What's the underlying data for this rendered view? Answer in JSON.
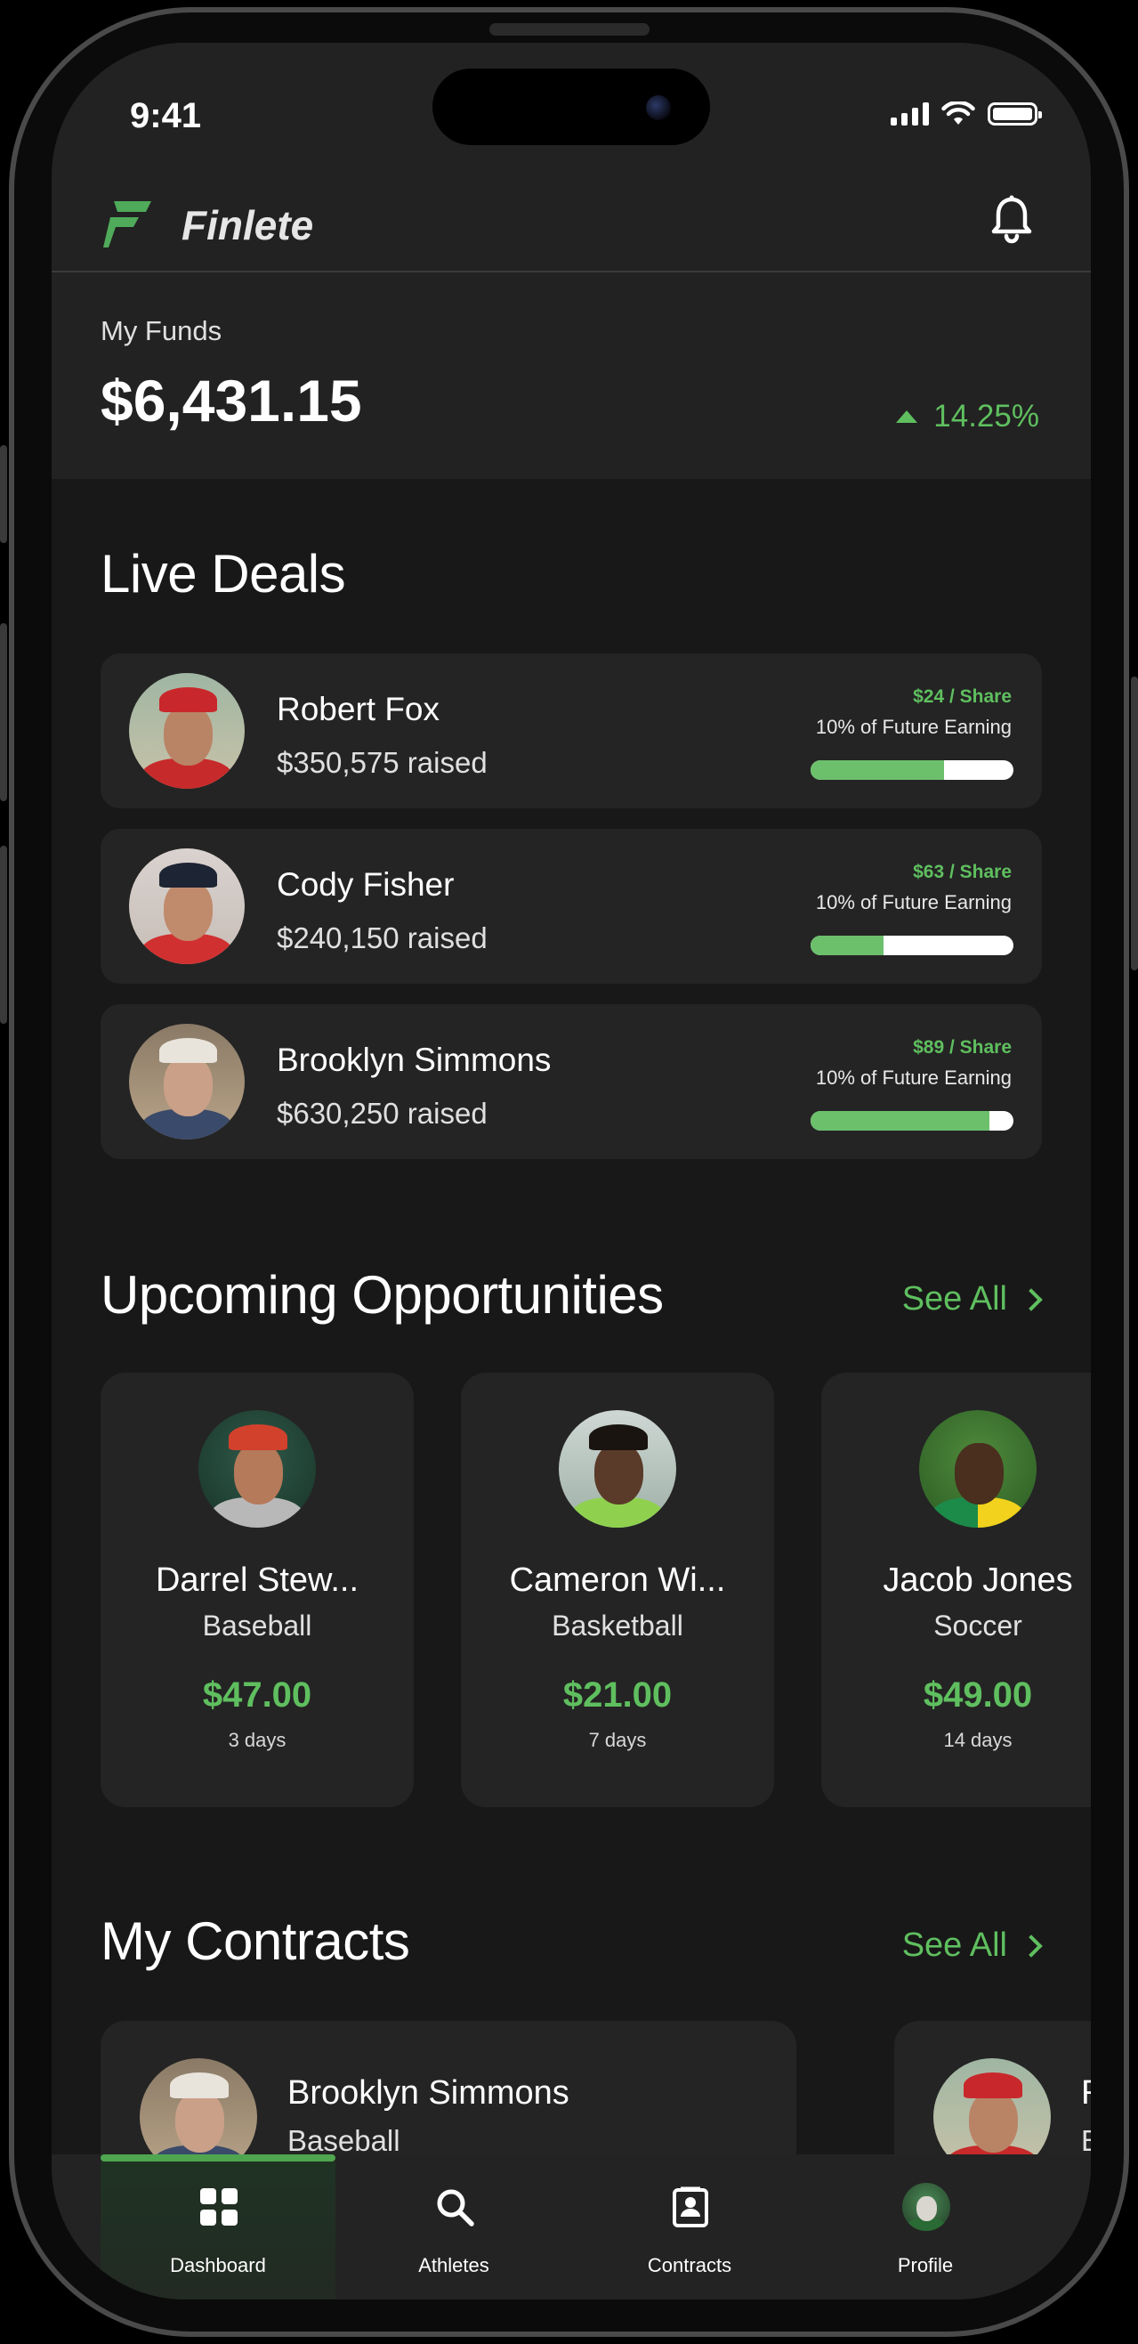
{
  "status_bar": {
    "time": "9:41"
  },
  "header": {
    "brand": "Finlete"
  },
  "funds": {
    "label": "My Funds",
    "amount": "$6,431.15",
    "change": "14.25%"
  },
  "live_deals": {
    "title": "Live Deals",
    "items": [
      {
        "name": "Robert Fox",
        "raised": "$350,575 raised",
        "price": "$24 / Share",
        "earning": "10% of Future Earning",
        "progress": 0.66
      },
      {
        "name": "Cody Fisher",
        "raised": "$240,150 raised",
        "price": "$63 / Share",
        "earning": "10% of Future Earning",
        "progress": 0.36
      },
      {
        "name": "Brooklyn Simmons",
        "raised": "$630,250 raised",
        "price": "$89 / Share",
        "earning": "10% of Future Earning",
        "progress": 0.88
      }
    ]
  },
  "opportunities": {
    "title": "Upcoming Opportunities",
    "see_all": "See All",
    "items": [
      {
        "name": "Darrel Stew...",
        "sport": "Baseball",
        "price": "$47.00",
        "days": "3 days"
      },
      {
        "name": "Cameron Wi...",
        "sport": "Basketball",
        "price": "$21.00",
        "days": "7 days"
      },
      {
        "name": "Jacob Jones",
        "sport": "Soccer",
        "price": "$49.00",
        "days": "14 days"
      }
    ]
  },
  "contracts": {
    "title": "My Contracts",
    "see_all": "See All",
    "items": [
      {
        "name": "Brooklyn Simmons",
        "sport": "Baseball"
      },
      {
        "name": "Rob",
        "sport": "Base"
      }
    ]
  },
  "tabs": [
    {
      "label": "Dashboard",
      "icon": "grid-icon",
      "active": true
    },
    {
      "label": "Athletes",
      "icon": "search-icon",
      "active": false
    },
    {
      "label": "Contracts",
      "icon": "contract-icon",
      "active": false
    },
    {
      "label": "Profile",
      "icon": "profile-avatar-icon",
      "active": false
    }
  ],
  "colors": {
    "accent": "#5fbf5f",
    "card": "#242424",
    "background": "#181818",
    "panel": "#222222"
  }
}
